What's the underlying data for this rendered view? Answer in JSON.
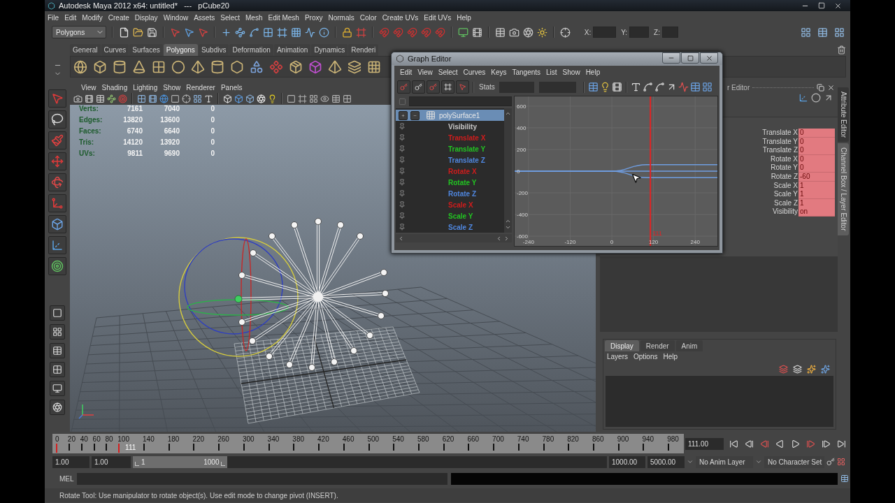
{
  "window": {
    "title": "Autodesk Maya 2012 x64: untitled*   ---   pCube20"
  },
  "menu_bar": [
    "File",
    "Edit",
    "Modify",
    "Create",
    "Display",
    "Window",
    "Assets",
    "Select",
    "Mesh",
    "Edit Mesh",
    "Proxy",
    "Normals",
    "Color",
    "Create UVs",
    "Edit UVs",
    "Help"
  ],
  "status_line": {
    "menu_set": "Polygons",
    "coordinate_fields": [
      {
        "label": "X:"
      },
      {
        "label": "Y:"
      },
      {
        "label": "Z:"
      }
    ]
  },
  "shelf": {
    "tabs": [
      {
        "label": "General",
        "selected": false
      },
      {
        "label": "Curves",
        "selected": false
      },
      {
        "label": "Surfaces",
        "selected": false
      },
      {
        "label": "Polygons",
        "selected": true
      },
      {
        "label": "Subdivs",
        "selected": false
      },
      {
        "label": "Deformation",
        "selected": false
      },
      {
        "label": "Animation",
        "selected": false
      },
      {
        "label": "Dynamics",
        "selected": false
      },
      {
        "label": "Renderi",
        "selected": false
      }
    ]
  },
  "viewport": {
    "menu": [
      "View",
      "Shading",
      "Lighting",
      "Show",
      "Renderer",
      "Panels"
    ],
    "hud": [
      {
        "label": "Verts:",
        "values": [
          "7161",
          "7040",
          "0"
        ]
      },
      {
        "label": "Edges:",
        "values": [
          "13820",
          "13600",
          "0"
        ]
      },
      {
        "label": "Faces:",
        "values": [
          "6740",
          "6640",
          "0"
        ]
      },
      {
        "label": "Tris:",
        "values": [
          "14120",
          "13920",
          "0"
        ]
      },
      {
        "label": "UVs:",
        "values": [
          "9811",
          "9690",
          "0"
        ]
      }
    ]
  },
  "graph_editor": {
    "title": "Graph Editor",
    "menu": [
      "Edit",
      "View",
      "Select",
      "Curves",
      "Keys",
      "Tangents",
      "List",
      "Show",
      "Help"
    ],
    "stats_label": "Stats",
    "outliner": {
      "object": {
        "name": "polySurface1",
        "selected": true
      },
      "channels": [
        {
          "name": "Visibility",
          "color": "#c8c8c8",
          "selected": false
        },
        {
          "name": "Translate X",
          "color": "#d01c1c",
          "selected": false
        },
        {
          "name": "Translate Y",
          "color": "#22c422",
          "selected": false
        },
        {
          "name": "Translate Z",
          "color": "#4f86de",
          "selected": false
        },
        {
          "name": "Rotate X",
          "color": "#d01c1c",
          "selected": false
        },
        {
          "name": "Rotate Y",
          "color": "#22c422",
          "selected": false
        },
        {
          "name": "Rotate Z",
          "color": "#4f86de",
          "selected": false
        },
        {
          "name": "Scale X",
          "color": "#d01c1c",
          "selected": false
        },
        {
          "name": "Scale Y",
          "color": "#22c422",
          "selected": false
        },
        {
          "name": "Scale Z",
          "color": "#4f86de",
          "selected": false
        }
      ]
    },
    "chart_data": {
      "type": "line",
      "x": [
        -280,
        0,
        100,
        304
      ],
      "series": [
        {
          "color": "#6f9de0",
          "values": [
            0,
            0,
            60,
            60
          ]
        },
        {
          "color": "#6f9de0",
          "values": [
            0,
            0,
            0,
            0
          ]
        },
        {
          "color": "#6f9de0",
          "values": [
            0,
            0,
            -60,
            -60
          ]
        }
      ],
      "xlim": [
        -280,
        304
      ],
      "ylim": [
        -690,
        690
      ],
      "xticks": [
        -240,
        -120,
        0,
        120,
        240
      ],
      "yticks": [
        -600,
        -400,
        -200,
        0,
        200,
        400,
        600
      ],
      "grid": true,
      "ref_lines": [
        {
          "axis": "x",
          "value": 111,
          "label": "111",
          "color": "#e02424"
        }
      ]
    }
  },
  "channel_box": {
    "header": "r Editor",
    "attributes": [
      {
        "name": "Translate X",
        "value": "0",
        "keyed": true
      },
      {
        "name": "Translate Y",
        "value": "0",
        "keyed": true
      },
      {
        "name": "Translate Z",
        "value": "0",
        "keyed": true
      },
      {
        "name": "Rotate X",
        "value": "0",
        "keyed": true
      },
      {
        "name": "Rotate Y",
        "value": "0",
        "keyed": true
      },
      {
        "name": "Rotate Z",
        "value": "-60",
        "keyed": true
      },
      {
        "name": "Scale X",
        "value": "1",
        "keyed": true
      },
      {
        "name": "Scale Y",
        "value": "1",
        "keyed": true
      },
      {
        "name": "Scale Z",
        "value": "1",
        "keyed": true
      },
      {
        "name": "Visibility",
        "value": "on",
        "keyed": true
      }
    ]
  },
  "side_tabs": [
    {
      "label": "Attribute Editor",
      "selected": false
    },
    {
      "label": "Channel Box / Layer Editor",
      "selected": true
    }
  ],
  "layer_editor": {
    "tabs": [
      {
        "label": "Display",
        "selected": true
      },
      {
        "label": "Render",
        "selected": false
      },
      {
        "label": "Anim",
        "selected": false
      }
    ],
    "menu": [
      "Layers",
      "Options",
      "Help"
    ]
  },
  "time_slider": {
    "ticks": [
      {
        "label": "0",
        "key": true
      },
      {
        "label": "20",
        "key": false
      },
      {
        "label": "40",
        "key": false
      },
      {
        "label": "60",
        "key": false
      },
      {
        "label": "80",
        "key": false
      },
      {
        "label": "100",
        "key": true
      },
      {
        "label": "140",
        "key": false
      },
      {
        "label": "180",
        "key": false
      },
      {
        "label": "220",
        "key": false
      },
      {
        "label": "260",
        "key": false
      },
      {
        "label": "300",
        "key": false
      },
      {
        "label": "340",
        "key": false
      },
      {
        "label": "380",
        "key": false
      },
      {
        "label": "420",
        "key": false
      },
      {
        "label": "460",
        "key": false
      },
      {
        "label": "500",
        "key": false
      },
      {
        "label": "540",
        "key": false
      },
      {
        "label": "580",
        "key": false
      },
      {
        "label": "620",
        "key": false
      },
      {
        "label": "660",
        "key": false
      },
      {
        "label": "700",
        "key": false
      },
      {
        "label": "740",
        "key": false
      },
      {
        "label": "780",
        "key": false
      },
      {
        "label": "820",
        "key": false
      },
      {
        "label": "860",
        "key": false
      },
      {
        "label": "900",
        "key": false
      },
      {
        "label": "940",
        "key": false
      },
      {
        "label": "980",
        "key": false
      }
    ],
    "level": 0.111,
    "current_frame": "111",
    "current_time": "111.00"
  },
  "range_slider": {
    "animation_start": "1.00",
    "playback_start": "1.00",
    "range_start": "1",
    "range_end": "1000",
    "playback_end": "1000.00",
    "animation_end": "5000.00",
    "anim_layer": "No Anim Layer",
    "character_set": "No Character Set"
  },
  "command_line": {
    "language": "MEL"
  },
  "help_line": "Rotate Tool: Use manipulator to rotate object(s). Use edit mode to change pivot (INSERT)."
}
